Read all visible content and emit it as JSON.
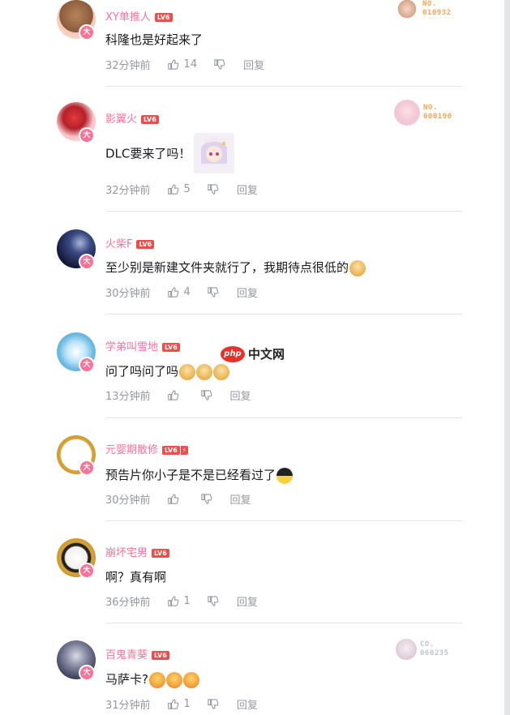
{
  "colors": {
    "accent": "#fb7299",
    "level_badge": "#f04c49",
    "meta_text": "#9499a0",
    "divider": "#e3e5e7",
    "fan_badge_orange": "#f5a554"
  },
  "comments": [
    {
      "username": "XY单推人",
      "level": "LV6",
      "avatar_badge": "大",
      "text": "科隆也是好起来了",
      "emotes": [],
      "time": "32分钟前",
      "likes": "14",
      "reply_label": "回复",
      "fan_badge": {
        "label": "NO.",
        "number": "010932",
        "color": "#f5a554"
      }
    },
    {
      "username": "影翼火",
      "level": "LV6",
      "avatar_badge": "大",
      "text": "DLC要来了吗！",
      "emotes": [],
      "sticker": "anime-girl-sticker",
      "time": "32分钟前",
      "likes": "5",
      "reply_label": "回复",
      "fan_badge": {
        "label": "NO.",
        "number": "000190",
        "color": "#f5a554"
      }
    },
    {
      "username": "火柴F",
      "level": "LV6",
      "avatar_badge": "大",
      "text": "至少别是新建文件夹就行了，我期待点很低的",
      "emotes": [
        "doge-emote"
      ],
      "time": "30分钟前",
      "likes": "4",
      "reply_label": "回复"
    },
    {
      "username": "学弟叫雪地",
      "level": "LV6",
      "avatar_badge": "大",
      "text": "问了吗问了吗",
      "emotes": [
        "doge-emote",
        "doge-emote",
        "doge-emote"
      ],
      "time": "13分钟前",
      "likes": "",
      "reply_label": "回复"
    },
    {
      "username": "元婴期散修",
      "level": "LV6",
      "level_plus": true,
      "avatar_badge": "大",
      "text": "预告片你小子是不是已经看过了",
      "emotes": [
        "smirk-emote"
      ],
      "time": "30分钟前",
      "likes": "",
      "reply_label": "回复"
    },
    {
      "username": "崩坏宅男",
      "level": "LV6",
      "avatar_badge": "大",
      "text": "啊？真有啊",
      "emotes": [],
      "time": "36分钟前",
      "likes": "1",
      "reply_label": "回复"
    },
    {
      "username": "百鬼青葵",
      "level": "LV6",
      "avatar_badge": "大",
      "text": "马萨卡?",
      "emotes": [
        "cry-emote",
        "cry-emote",
        "cry-emote"
      ],
      "time": "31分钟前",
      "likes": "1",
      "reply_label": "回复",
      "fan_badge": {
        "label": "CO.",
        "number": "060235",
        "color": "#c0c4cc"
      }
    }
  ],
  "watermark": {
    "logo": "php",
    "text": "中文网"
  }
}
